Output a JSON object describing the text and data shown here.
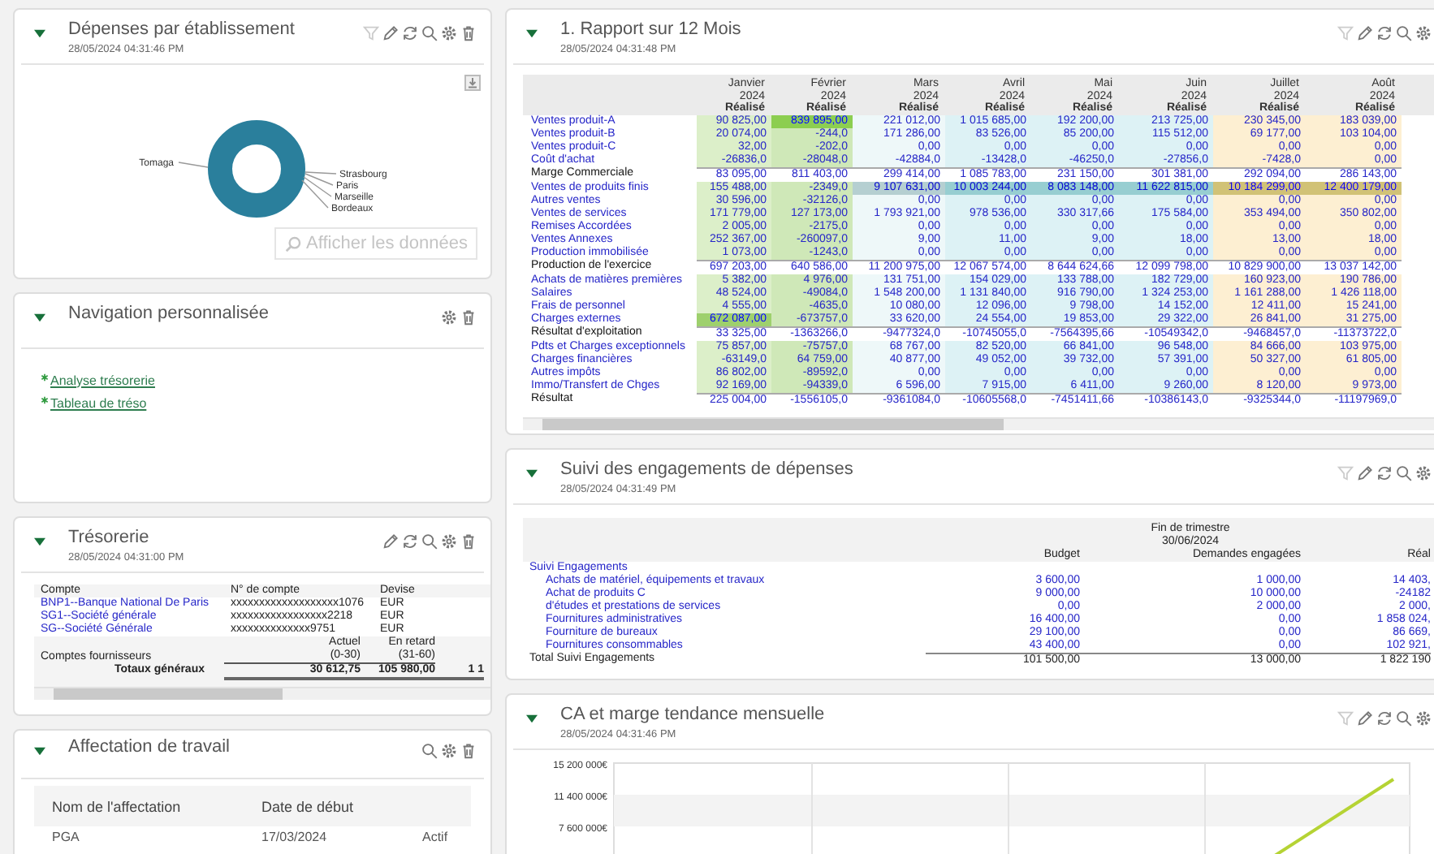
{
  "left_panels": [
    {
      "kind": "donut_chart",
      "title": "Dépenses par établissement",
      "date": "28/05/2024 04:31:46 PM",
      "expanded": true,
      "tools": [
        {
          "kind": "filter",
          "disabled": true
        },
        {
          "kind": "edit",
          "disabled": false
        },
        {
          "kind": "refresh",
          "disabled": false
        },
        {
          "kind": "search",
          "disabled": false
        },
        {
          "kind": "settings",
          "disabled": false
        },
        {
          "kind": "delete",
          "disabled": false
        }
      ],
      "labels": [
        "Tomaga",
        "Strasbourg",
        "Paris",
        "Marseille",
        "Bordeaux"
      ],
      "show_data": {
        "label": "Afficher les données",
        "disabled": true
      }
    },
    {
      "kind": "links",
      "title": "Navigation personnalisée",
      "expanded": true,
      "tools": [
        {
          "kind": "settings",
          "disabled": false
        },
        {
          "kind": "delete",
          "disabled": false
        }
      ],
      "links": [
        "Analyse trésorerie",
        "Tableau de tréso"
      ]
    },
    {
      "kind": "accounts_table",
      "title": "Trésorerie",
      "date": "28/05/2024 04:31:00 PM",
      "expanded": true,
      "tools": [
        {
          "kind": "edit",
          "disabled": false
        },
        {
          "kind": "refresh",
          "disabled": false
        },
        {
          "kind": "search",
          "disabled": false
        },
        {
          "kind": "settings",
          "disabled": false
        },
        {
          "kind": "delete",
          "disabled": false
        }
      ],
      "columns": [
        "Compte",
        "N° de compte",
        "Devise"
      ],
      "rows": [
        {
          "account": "BNP1--Banque National De Paris",
          "number": "xxxxxxxxxxxxxxxxxxx1076",
          "currency": "EUR"
        },
        {
          "account": "SG1--Société générale",
          "number": "xxxxxxxxxxxxxxxxx2218",
          "currency": "EUR"
        },
        {
          "account": "SG--Société Générale",
          "number": "xxxxxxxxxxxxxx9751",
          "currency": "EUR"
        }
      ],
      "aging": {
        "label": "Comptes fournisseurs",
        "columns": [
          {
            "title": "Actuel",
            "range": "(0-30)"
          },
          {
            "title": "En retard",
            "range": "(31-60)"
          }
        ],
        "total_label": "Totaux généraux",
        "totals": [
          "30 612,75",
          "105 980,00",
          "1 1"
        ]
      }
    },
    {
      "kind": "assignment_table",
      "title": "Affectation de travail",
      "expanded": true,
      "tools": [
        {
          "kind": "search",
          "disabled": false
        },
        {
          "kind": "settings",
          "disabled": false
        },
        {
          "kind": "delete",
          "disabled": false
        }
      ],
      "columns": [
        "Nom de l'affectation",
        "Date de début"
      ],
      "rows": [
        [
          "PGA",
          "17/03/2024",
          "Actif"
        ]
      ]
    }
  ],
  "right_panels": [
    {
      "kind": "monthly_report",
      "title": "1. Rapport sur 12 Mois",
      "date": "28/05/2024 04:31:48 PM",
      "expanded": true,
      "tools": [
        {
          "kind": "filter",
          "disabled": true
        },
        {
          "kind": "edit",
          "disabled": false
        },
        {
          "kind": "refresh",
          "disabled": false
        },
        {
          "kind": "search",
          "disabled": false
        },
        {
          "kind": "settings",
          "disabled": false
        }
      ],
      "columns": [
        {
          "month": "Janvier",
          "year": "2024",
          "measure": "Réalisé",
          "color": "#dcefc9"
        },
        {
          "month": "Février",
          "year": "2024",
          "measure": "Réalisé",
          "color": "#cfe8b8"
        },
        {
          "month": "Mars",
          "year": "2024",
          "measure": "Réalisé",
          "color": "#eef8f9"
        },
        {
          "month": "Avril",
          "year": "2024",
          "measure": "Réalisé",
          "color": "#ddf2f5"
        },
        {
          "month": "Mai",
          "year": "2024",
          "measure": "Réalisé",
          "color": "#ddf2f5"
        },
        {
          "month": "Juin",
          "year": "2024",
          "measure": "Réalisé",
          "color": "#ddf2f5"
        },
        {
          "month": "Juillet",
          "year": "2024",
          "measure": "Réalisé",
          "color": "#fdefd2"
        },
        {
          "month": "Août",
          "year": "2024",
          "measure": "Réalisé",
          "color": "#fdefd2"
        }
      ],
      "rows": [
        {
          "label": "Ventes produit-A",
          "kind": "account",
          "values": [
            "90 825,00",
            "839 895,00",
            "221 012,00",
            "1 015 685,00",
            "192 200,00",
            "213 725,00",
            "230 345,00",
            "183 039,00"
          ],
          "highlighted": [
            false,
            true,
            false,
            false,
            false,
            false,
            false,
            false
          ]
        },
        {
          "label": "Ventes produit-B",
          "kind": "account",
          "values": [
            "20 074,00",
            "-244,0",
            "171 286,00",
            "83 526,00",
            "85 200,00",
            "115 512,00",
            "69 177,00",
            "103 104,00"
          ],
          "highlighted": [
            false,
            false,
            false,
            false,
            false,
            false,
            false,
            false
          ]
        },
        {
          "label": "Ventes produit-C",
          "kind": "account",
          "values": [
            "32,00",
            "-202,0",
            "0,00",
            "0,00",
            "0,00",
            "0,00",
            "0,00",
            "0,00"
          ],
          "highlighted": [
            false,
            false,
            false,
            false,
            false,
            false,
            false,
            false
          ]
        },
        {
          "label": "Coût d'achat",
          "kind": "account",
          "values": [
            "-26836,0",
            "-28048,0",
            "-42884,0",
            "-13428,0",
            "-46250,0",
            "-27856,0",
            "-7428,0",
            "0,00"
          ],
          "highlighted": [
            false,
            false,
            false,
            false,
            false,
            false,
            false,
            false
          ]
        },
        {
          "label": "Marge Commerciale",
          "kind": "total",
          "values": [
            "83 095,00",
            "811 403,00",
            "299 414,00",
            "1 085 783,00",
            "231 150,00",
            "301 381,00",
            "292 094,00",
            "286 143,00"
          ],
          "highlighted": [
            false,
            false,
            false,
            false,
            false,
            false,
            false,
            false
          ]
        },
        {
          "label": "Ventes de produits finis",
          "kind": "account",
          "values": [
            "155 488,00",
            "-2349,0",
            "9 107 631,00",
            "10 003 244,00",
            "8 083 148,00",
            "11 622 815,00",
            "10 184 299,00",
            "12 400 179,00"
          ],
          "highlighted": [
            false,
            false,
            true,
            true,
            true,
            true,
            true,
            true
          ]
        },
        {
          "label": "Autres ventes",
          "kind": "account",
          "values": [
            "30 596,00",
            "-32126,0",
            "0,00",
            "0,00",
            "0,00",
            "0,00",
            "0,00",
            "0,00"
          ],
          "highlighted": [
            false,
            false,
            false,
            false,
            false,
            false,
            false,
            false
          ]
        },
        {
          "label": "Ventes de services",
          "kind": "account",
          "values": [
            "171 779,00",
            "127 173,00",
            "1 793 921,00",
            "978 536,00",
            "330 317,66",
            "175 584,00",
            "353 494,00",
            "350 802,00"
          ],
          "highlighted": [
            false,
            false,
            false,
            false,
            false,
            false,
            false,
            false
          ]
        },
        {
          "label": "Remises Accordées",
          "kind": "account",
          "values": [
            "2 005,00",
            "-2175,0",
            "0,00",
            "0,00",
            "0,00",
            "0,00",
            "0,00",
            "0,00"
          ],
          "highlighted": [
            false,
            false,
            false,
            false,
            false,
            false,
            false,
            false
          ]
        },
        {
          "label": "Ventes Annexes",
          "kind": "account",
          "values": [
            "252 367,00",
            "-260097,0",
            "9,00",
            "11,00",
            "9,00",
            "18,00",
            "13,00",
            "18,00"
          ],
          "highlighted": [
            false,
            false,
            false,
            false,
            false,
            false,
            false,
            false
          ]
        },
        {
          "label": "Production immobilisée",
          "kind": "account",
          "values": [
            "1 073,00",
            "-1243,0",
            "0,00",
            "0,00",
            "0,00",
            "0,00",
            "0,00",
            "0,00"
          ],
          "highlighted": [
            false,
            false,
            false,
            false,
            false,
            false,
            false,
            false
          ]
        },
        {
          "label": "Production de l'exercice",
          "kind": "total",
          "values": [
            "697 203,00",
            "640 586,00",
            "11 200 975,00",
            "12 067 574,00",
            "8 644 624,66",
            "12 099 798,00",
            "10 829 900,00",
            "13 037 142,00"
          ],
          "highlighted": [
            false,
            false,
            false,
            false,
            false,
            false,
            false,
            false
          ]
        },
        {
          "label": "Achats de matières premières",
          "kind": "account",
          "values": [
            "5 382,00",
            "4 976,00",
            "131 751,00",
            "154 029,00",
            "133 788,00",
            "182 729,00",
            "160 923,00",
            "190 786,00"
          ],
          "highlighted": [
            false,
            false,
            false,
            false,
            false,
            false,
            false,
            false
          ]
        },
        {
          "label": "Salaires",
          "kind": "account",
          "values": [
            "48 524,00",
            "-49084,0",
            "1 548 200,00",
            "1 131 840,00",
            "916 790,00",
            "1 324 253,00",
            "1 161 288,00",
            "1 426 118,00"
          ],
          "highlighted": [
            false,
            false,
            false,
            false,
            false,
            false,
            false,
            false
          ]
        },
        {
          "label": "Frais de personnel",
          "kind": "account",
          "values": [
            "4 555,00",
            "-4635,0",
            "10 080,00",
            "12 096,00",
            "9 798,00",
            "14 152,00",
            "12 411,00",
            "15 241,00"
          ],
          "highlighted": [
            false,
            false,
            false,
            false,
            false,
            false,
            false,
            false
          ]
        },
        {
          "label": "Charges externes",
          "kind": "account",
          "values": [
            "672 087,00",
            "-673757,0",
            "33 620,00",
            "24 554,00",
            "19 853,00",
            "29 322,00",
            "26 841,00",
            "31 275,00"
          ],
          "highlighted": [
            true,
            false,
            false,
            false,
            false,
            false,
            false,
            false
          ]
        },
        {
          "label": "Résultat d'exploitation",
          "kind": "total",
          "values": [
            "33 325,00",
            "-1363266,0",
            "-9477324,0",
            "-10745055,0",
            "-7564395,66",
            "-10549342,0",
            "-9468457,0",
            "-11373722,0"
          ],
          "highlighted": [
            false,
            false,
            false,
            false,
            false,
            false,
            false,
            false
          ]
        },
        {
          "label": "Pdts et Charges exceptionnels",
          "kind": "account",
          "values": [
            "75 857,00",
            "-75757,0",
            "68 767,00",
            "82 520,00",
            "66 841,00",
            "96 548,00",
            "84 666,00",
            "103 975,00"
          ],
          "highlighted": [
            false,
            false,
            false,
            false,
            false,
            false,
            false,
            false
          ]
        },
        {
          "label": "Charges financières",
          "kind": "account",
          "values": [
            "-63149,0",
            "64 759,00",
            "40 877,00",
            "49 052,00",
            "39 732,00",
            "57 391,00",
            "50 327,00",
            "61 805,00"
          ],
          "highlighted": [
            false,
            false,
            false,
            false,
            false,
            false,
            false,
            false
          ]
        },
        {
          "label": "Autres impôts",
          "kind": "account",
          "values": [
            "86 802,00",
            "-89592,0",
            "0,00",
            "0,00",
            "0,00",
            "0,00",
            "0,00",
            "0,00"
          ],
          "highlighted": [
            false,
            false,
            false,
            false,
            false,
            false,
            false,
            false
          ]
        },
        {
          "label": "Immo/Transfert de Chges",
          "kind": "account",
          "values": [
            "92 169,00",
            "-94339,0",
            "6 596,00",
            "7 915,00",
            "6 411,00",
            "9 260,00",
            "8 120,00",
            "9 973,00"
          ],
          "highlighted": [
            false,
            false,
            false,
            false,
            false,
            false,
            false,
            false
          ]
        },
        {
          "label": "Résultat",
          "kind": "total",
          "values": [
            "225 004,00",
            "-1556105,0",
            "-9361084,0",
            "-10605568,0",
            "-7451411,66",
            "-10386143,0",
            "-9325344,0",
            "-11197969,0"
          ],
          "highlighted": [
            false,
            false,
            false,
            false,
            false,
            false,
            false,
            false
          ]
        }
      ]
    },
    {
      "kind": "commitments_table",
      "title": "Suivi des engagements de dépenses",
      "date": "28/05/2024 04:31:49 PM",
      "expanded": true,
      "tools": [
        {
          "kind": "filter",
          "disabled": true
        },
        {
          "kind": "edit",
          "disabled": false
        },
        {
          "kind": "refresh",
          "disabled": false
        },
        {
          "kind": "search",
          "disabled": false
        },
        {
          "kind": "settings",
          "disabled": false
        }
      ],
      "period": "Fin de trimestre",
      "period_date": "30/06/2024",
      "columns": [
        "Budget",
        "Demandes engagées",
        "Réal"
      ],
      "group": "Suivi Engagements",
      "rows": [
        {
          "label": "Achats de matériel, équipements et travaux",
          "values": [
            "3 600,00",
            "1 000,00",
            "14 403,"
          ]
        },
        {
          "label": "Achat de produits C",
          "values": [
            "9 000,00",
            "10 000,00",
            "-24182"
          ]
        },
        {
          "label": "d'études et prestations de services",
          "values": [
            "0,00",
            "2 000,00",
            "2 000,"
          ]
        },
        {
          "label": "Fournitures administratives",
          "values": [
            "16 400,00",
            "0,00",
            "1 858 024,"
          ]
        },
        {
          "label": "Fourniture de bureaux",
          "values": [
            "29 100,00",
            "0,00",
            "86 669,"
          ]
        },
        {
          "label": "Fournitures consommables",
          "values": [
            "43 400,00",
            "0,00",
            "102 921,"
          ]
        }
      ],
      "total": {
        "label": "Total Suivi Engagements",
        "values": [
          "101 500,00",
          "13 000,00",
          "1 822 190"
        ]
      }
    },
    {
      "kind": "trend_chart",
      "title": "CA et marge tendance mensuelle",
      "date": "28/05/2024 04:31:46 PM",
      "expanded": true,
      "tools": [
        {
          "kind": "filter",
          "disabled": true
        },
        {
          "kind": "edit",
          "disabled": false
        },
        {
          "kind": "refresh",
          "disabled": false
        },
        {
          "kind": "search",
          "disabled": false
        },
        {
          "kind": "settings",
          "disabled": false
        }
      ],
      "y_ticks": [
        "15 200 000€",
        "11 400 000€",
        "7 600 000€"
      ]
    }
  ]
}
